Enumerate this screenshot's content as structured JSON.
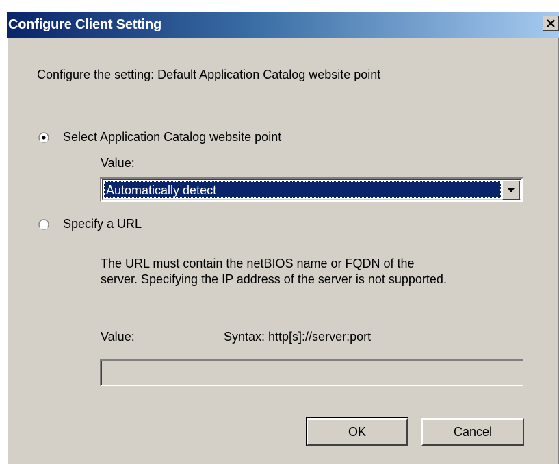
{
  "window": {
    "title": "Configure Client Setting",
    "close_label": "X"
  },
  "intro": "Configure the setting: Default Application Catalog website point",
  "option_select": {
    "label": "Select Application Catalog website point",
    "selected": true,
    "value_label": "Value:",
    "combo_value": "Automatically detect"
  },
  "option_url": {
    "label": "Specify a URL",
    "selected": false,
    "note_line1": "The URL must contain the netBIOS name or FQDN of the",
    "note_line2": "server. Specifying the IP address of the server is not supported.",
    "value_label": "Value:",
    "syntax": "Syntax: http[s]://server:port",
    "input_value": ""
  },
  "buttons": {
    "ok": "OK",
    "cancel": "Cancel"
  },
  "colors": {
    "dialog_bg": "#d4d0c8",
    "title_start": "#0a246a",
    "title_end": "#a6caf0",
    "selection": "#0a246a"
  },
  "icons": {
    "close": "close-icon",
    "dropdown": "chevron-down-icon",
    "radio_on": "radio-checked-icon",
    "radio_off": "radio-unchecked-icon"
  }
}
